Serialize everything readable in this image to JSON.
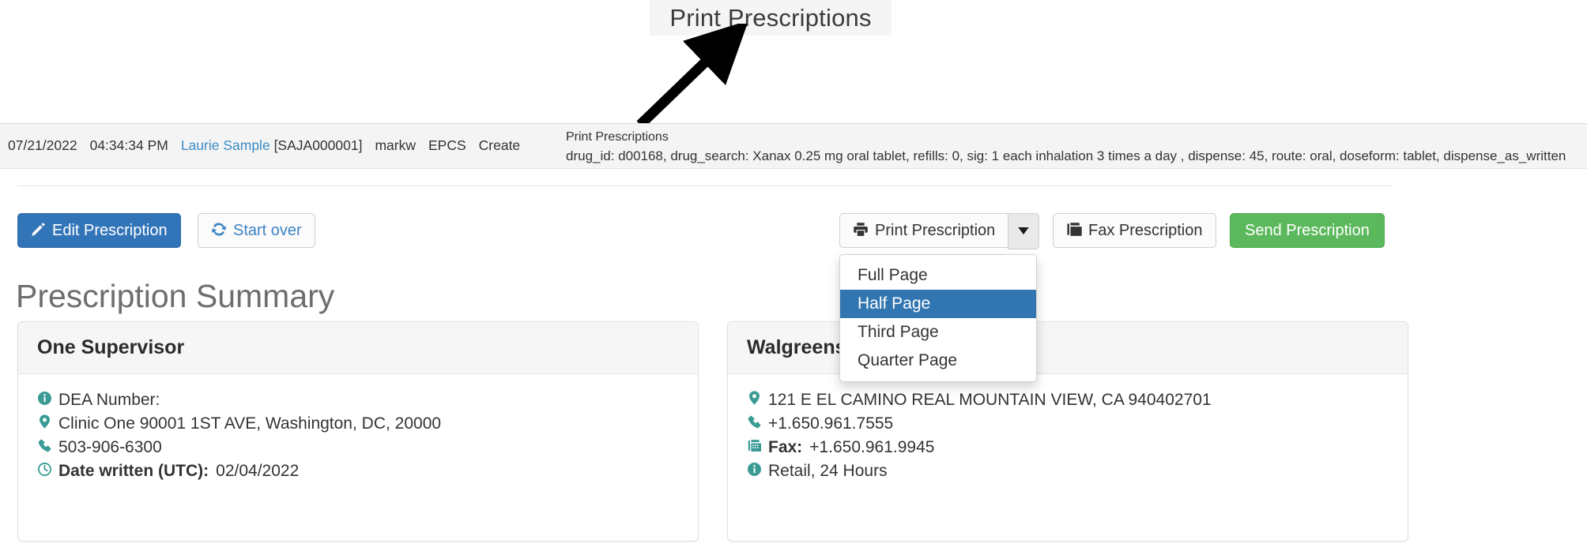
{
  "annotation": {
    "title": "Print Prescriptions",
    "arrow_icon": "arrow-up-right-icon"
  },
  "log": {
    "date": "07/21/2022",
    "time": "04:34:34 PM",
    "patient_name": "Laurie Sample",
    "patient_id": "[SAJA000001]",
    "user": "markw",
    "category": "EPCS",
    "action": "Create",
    "detail_title": "Print Prescriptions",
    "detail_text": "drug_id: d00168, drug_search: Xanax 0.25 mg oral tablet, refills: 0, sig: 1 each inhalation 3 times a day , dispense: 45, route: oral, doseform: tablet, dispense_as_written"
  },
  "toolbar": {
    "edit_label": "Edit Prescription",
    "edit_icon": "pencil-icon",
    "start_over_label": "Start over",
    "start_over_icon": "refresh-icon",
    "print_label": "Print Prescription",
    "print_icon": "printer-icon",
    "caret_icon": "chevron-down-icon",
    "fax_label": "Fax Prescription",
    "fax_icon": "fax-icon",
    "send_label": "Send Prescription"
  },
  "print_dropdown": {
    "options": [
      {
        "label": "Full Page",
        "selected": false
      },
      {
        "label": "Half Page",
        "selected": true
      },
      {
        "label": "Third Page",
        "selected": false
      },
      {
        "label": "Quarter Page",
        "selected": false
      }
    ]
  },
  "page": {
    "title": "Prescription Summary"
  },
  "prescriber_card": {
    "title": "One Supervisor",
    "dea_label": "DEA Number:",
    "dea_icon": "info-icon",
    "address": "Clinic One 90001 1ST AVE, Washington, DC, 20000",
    "address_icon": "map-pin-icon",
    "phone": "503-906-6300",
    "phone_icon": "phone-icon",
    "date_label": "Date written (UTC):",
    "date_value": "02/04/2022",
    "date_icon": "clock-icon"
  },
  "pharmacy_card": {
    "title": "Walgreens",
    "address": "121 E EL CAMINO REAL MOUNTAIN VIEW, CA 940402701",
    "address_icon": "map-pin-icon",
    "phone": "+1.650.961.7555",
    "phone_icon": "phone-icon",
    "fax_label": "Fax:",
    "fax_value": "+1.650.961.9945",
    "fax_icon": "fax-icon",
    "type": "Retail, 24 Hours",
    "type_icon": "info-icon"
  },
  "colors": {
    "primary_blue": "#3274b8",
    "success_green": "#5cb85c",
    "link_blue": "#3c8dc5",
    "highlight_blue": "#3276b1",
    "icon_teal": "#3a9b95"
  }
}
